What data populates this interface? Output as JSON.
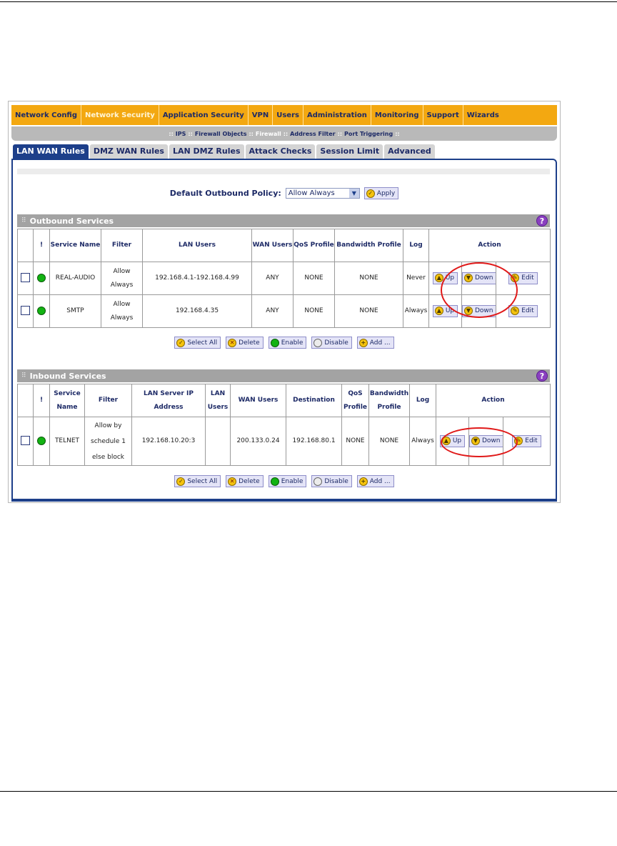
{
  "main_nav": [
    {
      "label": "Network Config",
      "active": false
    },
    {
      "label": "Network Security",
      "active": true
    },
    {
      "label": "Application Security",
      "active": false
    },
    {
      "label": "VPN",
      "active": false
    },
    {
      "label": "Users",
      "active": false
    },
    {
      "label": "Administration",
      "active": false
    },
    {
      "label": "Monitoring",
      "active": false
    },
    {
      "label": "Support",
      "active": false
    },
    {
      "label": "Wizards",
      "active": false
    }
  ],
  "sub_nav": [
    {
      "label": "IPS",
      "active": false
    },
    {
      "label": "Firewall Objects",
      "active": false
    },
    {
      "label": "Firewall",
      "active": true
    },
    {
      "label": "Address Filter",
      "active": false
    },
    {
      "label": "Port Triggering",
      "active": false
    }
  ],
  "sub_nav_separator": "::",
  "tabs": [
    {
      "label": "LAN WAN Rules",
      "active": true
    },
    {
      "label": "DMZ WAN Rules",
      "active": false
    },
    {
      "label": "LAN DMZ Rules",
      "active": false
    },
    {
      "label": "Attack Checks",
      "active": false
    },
    {
      "label": "Session Limit",
      "active": false
    },
    {
      "label": "Advanced",
      "active": false
    }
  ],
  "policy": {
    "label": "Default Outbound Policy:",
    "selected": "Allow Always",
    "apply_label": "Apply"
  },
  "outbound": {
    "title": "Outbound Services",
    "help": "?",
    "headers": {
      "status": "!",
      "service_name": "Service Name",
      "filter": "Filter",
      "lan_users": "LAN Users",
      "wan_users": "WAN Users",
      "qos": "QoS Profile",
      "bandwidth": "Bandwidth Profile",
      "log": "Log",
      "action": "Action"
    },
    "rows": [
      {
        "service": "REAL-AUDIO",
        "filter": "Allow Always",
        "lan_users": "192.168.4.1-192.168.4.99",
        "wan_users": "ANY",
        "qos": "NONE",
        "bandwidth": "NONE",
        "log": "Never"
      },
      {
        "service": "SMTP",
        "filter": "Allow Always",
        "lan_users": "192.168.4.35",
        "wan_users": "ANY",
        "qos": "NONE",
        "bandwidth": "NONE",
        "log": "Always"
      }
    ]
  },
  "inbound": {
    "title": "Inbound Services",
    "help": "?",
    "headers": {
      "status": "!",
      "service_name": "Service Name",
      "filter": "Filter",
      "lan_server_ip": "LAN Server IP Address",
      "lan_users": "LAN Users",
      "wan_users": "WAN Users",
      "destination": "Destination",
      "qos": "QoS Profile",
      "bandwidth": "Bandwidth Profile",
      "log": "Log",
      "action": "Action"
    },
    "rows": [
      {
        "service": "TELNET",
        "filter": "Allow by schedule 1 else block",
        "lan_server_ip": "192.168.10.20:3",
        "lan_users": "",
        "wan_users": "200.133.0.24",
        "destination": "192.168.80.1",
        "qos": "NONE",
        "bandwidth": "NONE",
        "log": "Always"
      }
    ]
  },
  "row_actions": {
    "up": "Up",
    "down": "Down",
    "edit": "Edit"
  },
  "bulk_actions": {
    "select_all": "Select All",
    "delete": "Delete",
    "enable": "Enable",
    "disable": "Disable",
    "add": "Add ..."
  },
  "colors": {
    "nav_orange": "#f3a811",
    "brand_blue": "#1d3f8a",
    "highlight_red": "#e01919",
    "status_green": "#12b312"
  }
}
